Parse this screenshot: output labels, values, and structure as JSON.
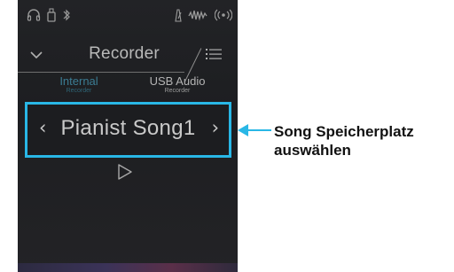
{
  "status_bar": {
    "icons": [
      "headphones-icon",
      "usb-drive-icon",
      "bluetooth-icon",
      "metronome-icon",
      "audio-wave-icon",
      "wireless-icon"
    ]
  },
  "header": {
    "title": "Recorder",
    "left_icon": "chevron-down-icon",
    "right_icon": "menu-list-icon"
  },
  "tabs": [
    {
      "label": "Internal",
      "sublabel": "Recorder",
      "active": true
    },
    {
      "label": "USB Audio",
      "sublabel": "Recorder",
      "active": false
    }
  ],
  "song_selector": {
    "prev_glyph": "‹",
    "song_name": "Pianist Song1",
    "next_glyph": "›"
  },
  "play_icon": "play-icon",
  "callout": {
    "line1": "Song Speicherplatz",
    "line2": "auswählen"
  },
  "colors": {
    "accent": "#29b7e6",
    "active_tab": "#3b7c93",
    "screen_bg": "#1f2023",
    "text": "#c9c9c9"
  }
}
